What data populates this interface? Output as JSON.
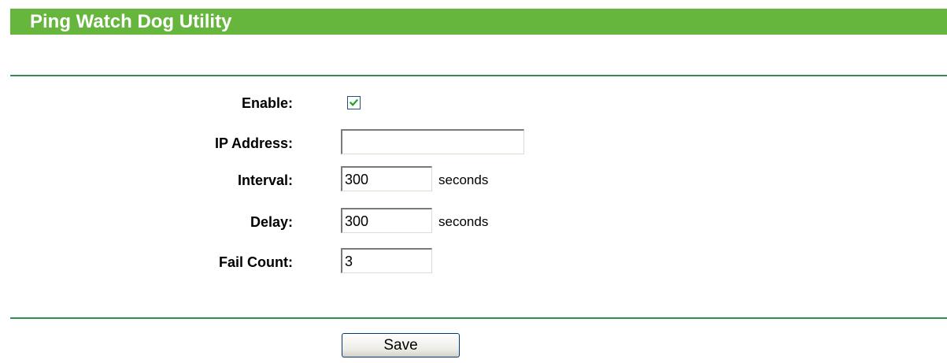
{
  "page": {
    "title": "Ping Watch Dog Utility"
  },
  "form": {
    "enable": {
      "label": "Enable:",
      "checked": true
    },
    "ip_address": {
      "label": "IP Address:",
      "value": ""
    },
    "interval": {
      "label": "Interval:",
      "value": "300",
      "unit": "seconds"
    },
    "delay": {
      "label": "Delay:",
      "value": "300",
      "unit": "seconds"
    },
    "fail_count": {
      "label": "Fail Count:",
      "value": "3"
    }
  },
  "actions": {
    "save_label": "Save"
  },
  "colors": {
    "title_bar": "#66b53c",
    "divider": "#2f8d4e",
    "checkbox_border": "#1c5180",
    "checkmark": "#21a121"
  }
}
